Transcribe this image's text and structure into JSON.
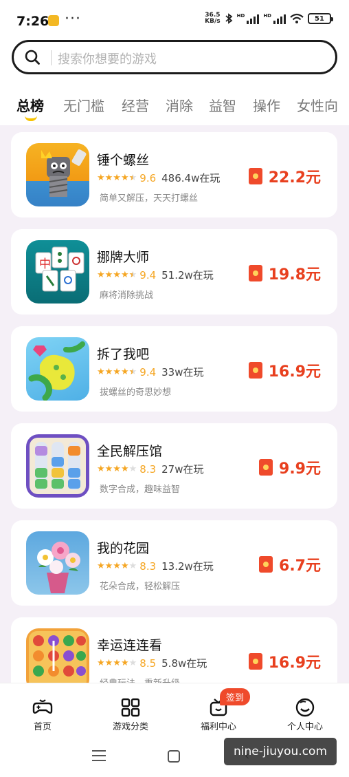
{
  "status_bar": {
    "time": "7:26",
    "more": "···",
    "net_speed": "36.5",
    "net_unit": "KB/s",
    "battery": "51"
  },
  "search": {
    "placeholder": "搜索你想要的游戏"
  },
  "tabs": [
    {
      "label": "总榜",
      "active": true
    },
    {
      "label": "无门槛"
    },
    {
      "label": "经营"
    },
    {
      "label": "消除"
    },
    {
      "label": "益智"
    },
    {
      "label": "操作"
    },
    {
      "label": "女性向"
    }
  ],
  "games": [
    {
      "title": "锤个螺丝",
      "score": "9.6",
      "players": "486.4w在玩",
      "desc": "简单又解压，天天打螺丝",
      "reward": "22.2元",
      "rating": 4.5,
      "icon": "screw-character-icon"
    },
    {
      "title": "挪牌大师",
      "score": "9.4",
      "players": "51.2w在玩",
      "desc": "麻将消除挑战",
      "reward": "19.8元",
      "rating": 4.5,
      "icon": "mahjong-tiles-icon"
    },
    {
      "title": "拆了我吧",
      "score": "9.4",
      "players": "33w在玩",
      "desc": "拔螺丝的奇思妙想",
      "reward": "16.9元",
      "rating": 4.5,
      "icon": "unscrew-puzzle-icon"
    },
    {
      "title": "全民解压馆",
      "score": "8.3",
      "players": "27w在玩",
      "desc": "数字合成，趣味益智",
      "reward": "9.9元",
      "rating": 4,
      "icon": "number-tubes-icon"
    },
    {
      "title": "我的花园",
      "score": "8.3",
      "players": "13.2w在玩",
      "desc": "花朵合成，轻松解压",
      "reward": "6.7元",
      "rating": 4,
      "icon": "flower-bouquet-icon"
    },
    {
      "title": "幸运连连看",
      "score": "8.5",
      "players": "5.8w在玩",
      "desc": "经典玩法，重新升级",
      "reward": "16.9元",
      "rating": 4,
      "icon": "fruit-match-icon"
    }
  ],
  "bottom_nav": [
    {
      "label": "首页",
      "icon": "gamepad-icon"
    },
    {
      "label": "游戏分类",
      "icon": "grid-icon"
    },
    {
      "label": "福利中心",
      "icon": "gift-tv-icon"
    },
    {
      "label": "个人中心",
      "icon": "smiley-face-icon"
    }
  ],
  "badge": "签到",
  "watermark": "nine-jiuyou.com",
  "colors": {
    "accent_yellow": "#f7c300",
    "reward_red": "#e8401f",
    "star": "#f5a623",
    "list_bg": "#f5f0f7"
  }
}
